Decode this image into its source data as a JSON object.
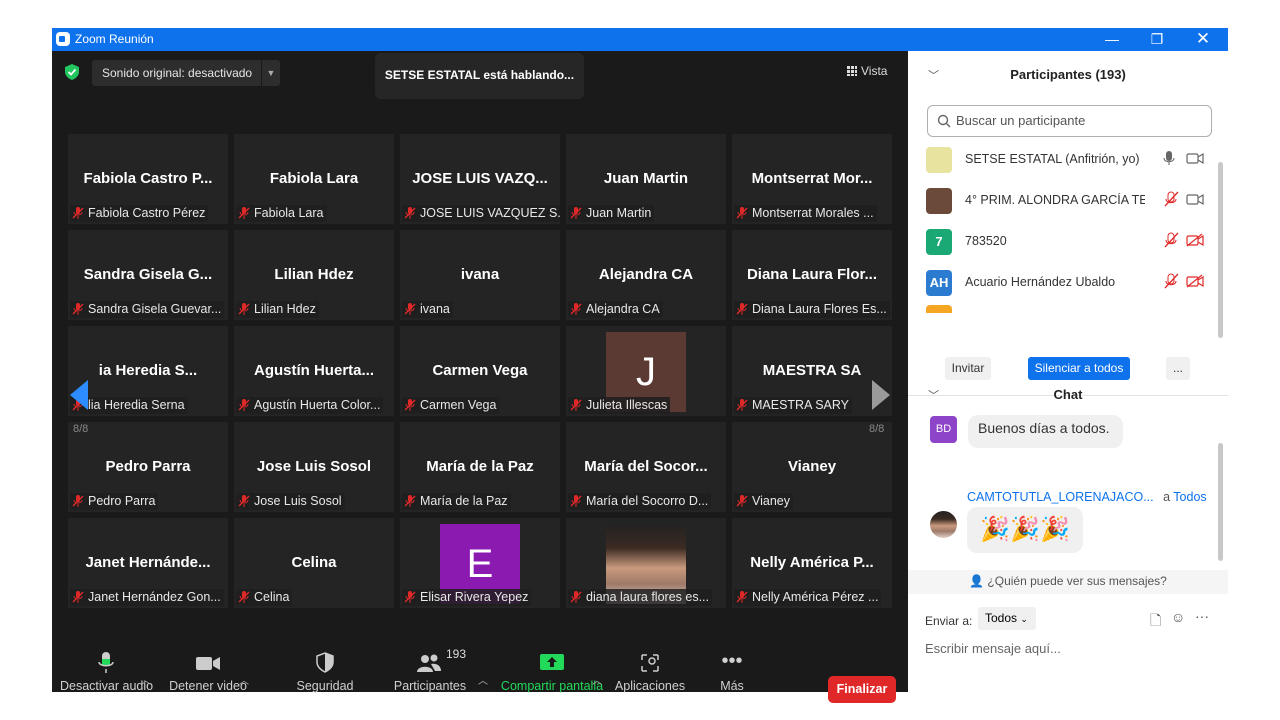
{
  "window": {
    "title": "Zoom Reunión"
  },
  "top": {
    "original_sound": "Sonido original: desactivado",
    "speaking": "SETSE ESTATAL está hablando...",
    "view": "Vista"
  },
  "grid": {
    "page_left": "8/8",
    "page_right": "8/8",
    "tiles": [
      {
        "big": "Fabiola Castro P...",
        "sub": "Fabiola Castro Pérez"
      },
      {
        "big": "Fabiola Lara",
        "sub": "Fabiola Lara"
      },
      {
        "big": "JOSE LUIS VAZQ...",
        "sub": "JOSE LUIS VAZQUEZ S."
      },
      {
        "big": "Juan Martin",
        "sub": "Juan Martin"
      },
      {
        "big": "Montserrat Mor...",
        "sub": "Montserrat Morales ..."
      },
      {
        "big": "Sandra Gisela G...",
        "sub": "Sandra Gisela Guevar..."
      },
      {
        "big": "Lilian Hdez",
        "sub": "Lilian Hdez"
      },
      {
        "big": "ivana",
        "sub": "ivana"
      },
      {
        "big": "Alejandra CA",
        "sub": "Alejandra CA"
      },
      {
        "big": "Diana Laura Flor...",
        "sub": "Diana Laura Flores Es..."
      },
      {
        "big": "ia Heredia S...",
        "sub": "lia Heredia Serna"
      },
      {
        "big": "Agustín Huerta...",
        "sub": "Agustín Huerta Color..."
      },
      {
        "big": "Carmen Vega",
        "sub": "Carmen Vega"
      },
      {
        "big": "",
        "avatar": "J",
        "sub": "Julieta Illescas"
      },
      {
        "big": "MAESTRA SA",
        "sub": "MAESTRA SARY"
      },
      {
        "big": "Pedro Parra",
        "sub": "Pedro Parra"
      },
      {
        "big": "Jose Luis Sosol",
        "sub": "Jose Luis Sosol"
      },
      {
        "big": "María de la Paz",
        "sub": "María de la Paz"
      },
      {
        "big": "María del Socor...",
        "sub": "María del Socorro D..."
      },
      {
        "big": "Vianey",
        "sub": "Vianey"
      },
      {
        "big": "Janet Hernánde...",
        "sub": "Janet Hernández Gon..."
      },
      {
        "big": "Celina",
        "sub": "Celina"
      },
      {
        "big": "",
        "avatar": "E",
        "sub": "Elisar Rivera Yepez"
      },
      {
        "big": "",
        "photo": true,
        "sub": "diana laura flores es..."
      },
      {
        "big": "Nelly América P...",
        "sub": "Nelly América Pérez ..."
      }
    ]
  },
  "toolbar": {
    "audio": "Desactivar audio",
    "video": "Detener video",
    "security": "Seguridad",
    "participants": "Participantes",
    "participants_count": "193",
    "share": "Compartir pantalla",
    "apps": "Aplicaciones",
    "more": "Más",
    "end": "Finalizar"
  },
  "participants": {
    "header": "Participantes (193)",
    "search_placeholder": "Buscar un participante",
    "list": [
      {
        "name": "SETSE ESTATAL (Anfitrión, yo)",
        "avatar": "",
        "color": "#e8e4a0"
      },
      {
        "name": "4° PRIM. ALONDRA GARCÍA TE...",
        "avatar": "",
        "color": "#6b4a3a"
      },
      {
        "name": "783520",
        "avatar": "7",
        "color": "#1aa875"
      },
      {
        "name": "Acuario Hernández Ubaldo",
        "avatar": "AH",
        "color": "#2b7bd0"
      }
    ],
    "invite": "Invitar",
    "mute_all": "Silenciar a todos",
    "more": "..."
  },
  "chat": {
    "header": "Chat",
    "messages": [
      {
        "avatar": "BD",
        "text": "Buenos días a todos."
      },
      {
        "sender": "CAMTOTUTLA_LORENAJACO...",
        "to_prefix": "a",
        "to": "Todos",
        "text": "🎉🎉🎉"
      }
    ],
    "who_can_see": "¿Quién puede ver sus mensajes?",
    "send_to_label": "Enviar a:",
    "send_to_value": "Todos",
    "input_placeholder": "Escribir mensaje aquí..."
  },
  "colors": {
    "accent": "#0e72ed",
    "end_red": "#e02828",
    "share_green": "#23d959",
    "muted_red": "#e02828"
  }
}
